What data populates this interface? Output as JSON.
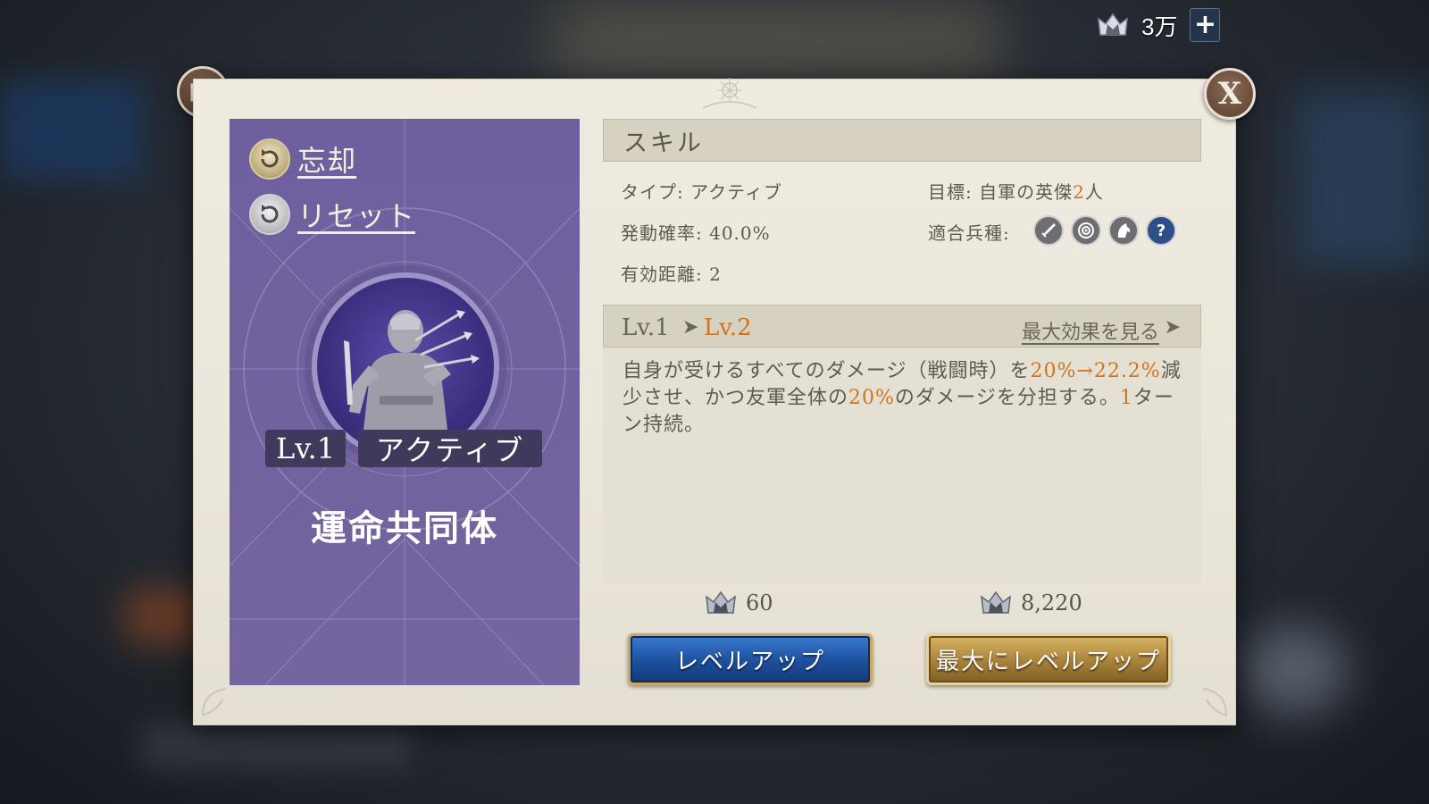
{
  "resource": {
    "value": "3万",
    "icon": "crown-crest-icon",
    "plus": "+"
  },
  "dialog": {
    "close_label": "X",
    "share_icon": "share-icon"
  },
  "skill_panel": {
    "forget_label": "忘却",
    "reset_label": "リセット",
    "level": "Lv.1",
    "type": "アクティブ",
    "name": "運命共同体",
    "bg_color": "#71629f"
  },
  "skill_info": {
    "header": "スキル",
    "type_label": "タイプ:",
    "type_value": "アクティブ",
    "target_label": "目標:",
    "target_prefix": "自軍の英傑",
    "target_count": "2",
    "target_suffix": "人",
    "trigger_label": "発動確率:",
    "trigger_value": "40.0%",
    "troop_label": "適合兵種:",
    "troop_icons": [
      "sword-icon",
      "target-icon",
      "horse-icon",
      "help-icon"
    ],
    "range_label": "有効距離:",
    "range_value": "2"
  },
  "level_bar": {
    "from": "Lv.1",
    "arrow": "➤",
    "to": "Lv.2",
    "max_effect": "最大効果を見る",
    "max_arrow": "➤"
  },
  "description": {
    "p1": "自身が受けるすべてのダメージ（戦闘時）を",
    "v1": "20%",
    "v2": "→22.2%",
    "p2": "減少させ、かつ友軍全体の",
    "v3": "20%",
    "p3": "のダメージを分担する。",
    "v4": "1",
    "p4": "ターン持続。"
  },
  "costs": {
    "level_up_cost": "60",
    "max_level_up_cost": "8,220"
  },
  "buttons": {
    "level_up": "レベルアップ",
    "max_level_up": "最大にレベルアップ"
  },
  "colors": {
    "accent": "#d2741e",
    "panel": "#71629f",
    "button_blue": "#1d4f9c",
    "button_gold": "#a9823a"
  }
}
